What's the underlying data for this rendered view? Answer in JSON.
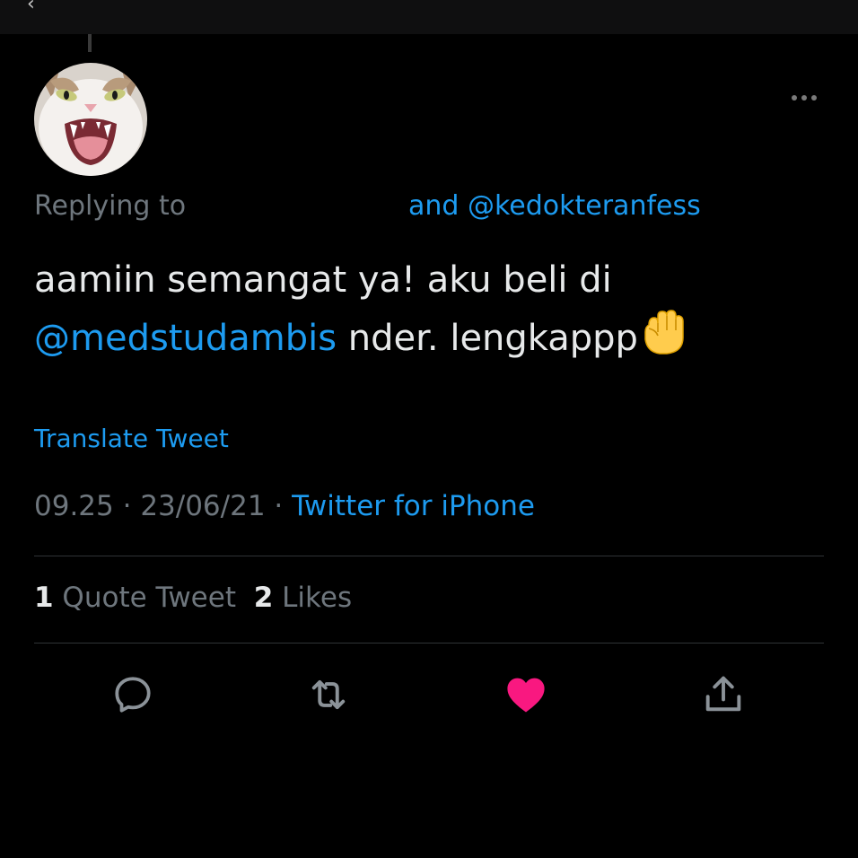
{
  "header": {
    "back_icon": "chevron-left-icon"
  },
  "tweet": {
    "avatar": "cat-avatar-image",
    "replying_prefix": "Replying to",
    "replying_mentions": "and @kedokteranfess",
    "text_line1": "aamiin semangat ya! aku beli di",
    "text_mention": "@medstudambis",
    "text_line2_rest": " nder. lengkappp",
    "emoji": "raised-fist",
    "translate_label": "Translate Tweet",
    "time": "09.25",
    "separator1": " · ",
    "date": "23/06/21",
    "separator2": " · ",
    "source": "Twitter for iPhone"
  },
  "stats": {
    "quote_count": "1",
    "quote_label": " Quote Tweet",
    "likes_count": "2",
    "likes_label": " Likes"
  },
  "actions": {
    "reply_icon": "reply-icon",
    "retweet_icon": "retweet-icon",
    "like_icon": "heart-icon",
    "share_icon": "share-icon"
  },
  "colors": {
    "background": "#000000",
    "text": "#e7e9ea",
    "secondary": "#6e767d",
    "link": "#1d9bf0",
    "like": "#f91880",
    "divider": "#2f3336"
  }
}
